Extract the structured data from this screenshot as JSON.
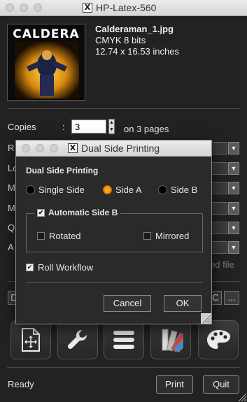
{
  "window": {
    "title": "HP-Latex-560"
  },
  "file": {
    "name": "Calderaman_1.jpg",
    "color": "CMYK 8 bits",
    "size": "12.74 x 16.53 inches",
    "thumb_title": "CALDERA"
  },
  "copies": {
    "label": "Copies",
    "colon": ":",
    "value": "3",
    "pages": "on 3 pages"
  },
  "hidden_row_labels": [
    "R",
    "Lo",
    "M",
    "M",
    "Q",
    "A"
  ],
  "ghost_text": "ed file",
  "row_buttons": {
    "left": "D",
    "right_a": "C",
    "right_b": "..."
  },
  "toolbar": {
    "icons": [
      "page-layout-icon",
      "wrench-icon",
      "stack-icon",
      "swatch-fan-icon",
      "palette-icon"
    ]
  },
  "status": "Ready",
  "buttons": {
    "print": "Print",
    "quit": "Quit"
  },
  "dialog": {
    "title": "Dual Side Printing",
    "heading": "Dual Side Printing",
    "radios": [
      {
        "label": "Single Side",
        "selected": false
      },
      {
        "label": "Side A",
        "selected": true
      },
      {
        "label": "Side B",
        "selected": false
      }
    ],
    "auto_side_b": {
      "label": "Automatic Side B",
      "checked": true
    },
    "rotated": {
      "label": "Rotated",
      "checked": false
    },
    "mirrored": {
      "label": "Mirrored",
      "checked": false
    },
    "roll_workflow": {
      "label": "Roll Workflow",
      "checked": true
    },
    "cancel": "Cancel",
    "ok": "OK"
  },
  "colors": {
    "accent_radio": "#f08c00",
    "background": "#222222"
  }
}
